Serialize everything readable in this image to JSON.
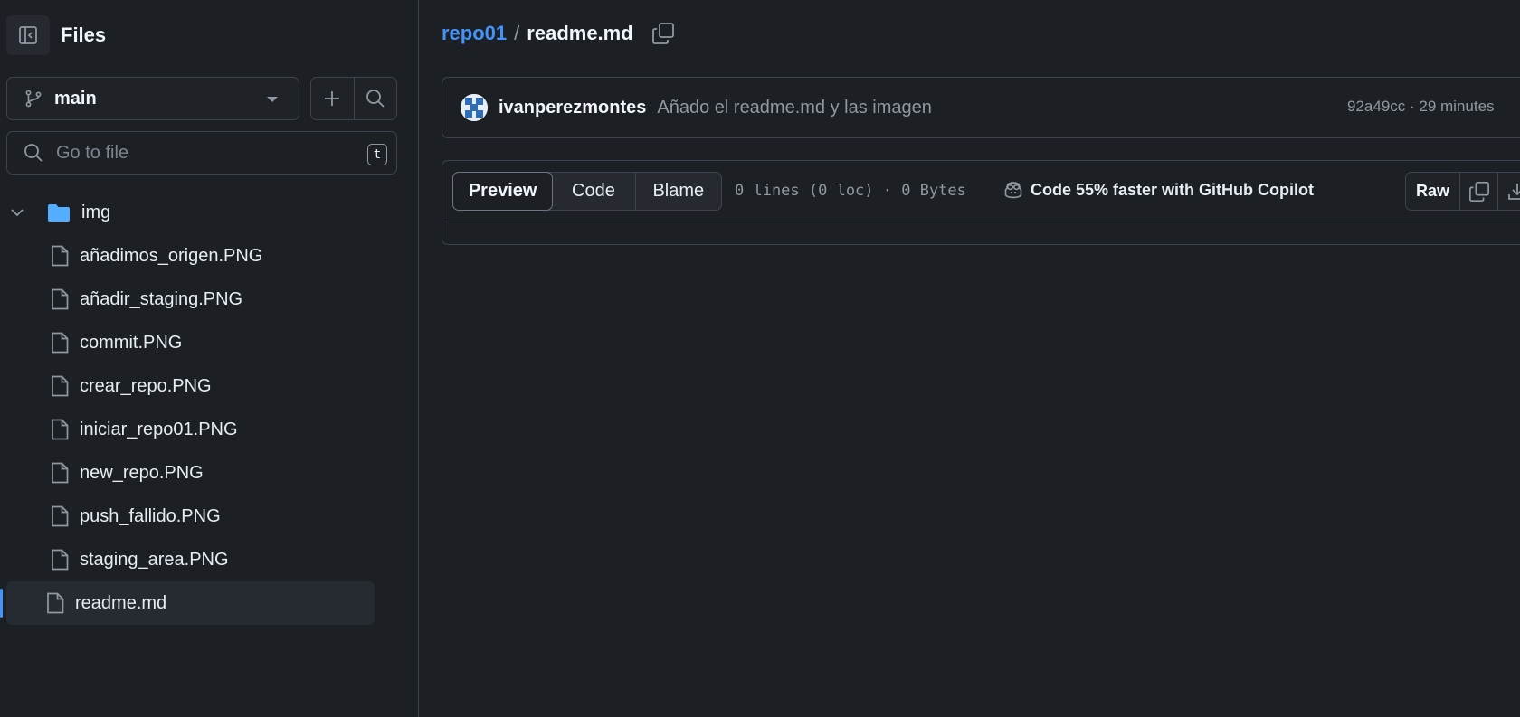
{
  "sidebar": {
    "title": "Files",
    "branch": "main",
    "search_placeholder": "Go to file",
    "search_shortcut": "t",
    "folder": {
      "name": "img",
      "expanded": true
    },
    "folder_files": [
      "añadimos_origen.PNG",
      "añadir_staging.PNG",
      "commit.PNG",
      "crear_repo.PNG",
      "iniciar_repo01.PNG",
      "new_repo.PNG",
      "push_fallido.PNG",
      "staging_area.PNG"
    ],
    "root_file": "readme.md"
  },
  "breadcrumb": {
    "repo": "repo01",
    "separator": "/",
    "file": "readme.md"
  },
  "commit": {
    "author": "ivanperezmontes",
    "message": "Añado el readme.md y las imagen",
    "meta": "92a49cc · 29 minutes"
  },
  "file_view": {
    "tabs": [
      "Preview",
      "Code",
      "Blame"
    ],
    "active_tab": "Preview",
    "meta": "0 lines (0 loc) · 0 Bytes",
    "copilot": "Code 55% faster with GitHub Copilot",
    "raw_label": "Raw"
  },
  "colors": {
    "accent": "#4493f8",
    "folder": "#54aeff",
    "background": "#1c1f23",
    "border": "#3d444d"
  }
}
